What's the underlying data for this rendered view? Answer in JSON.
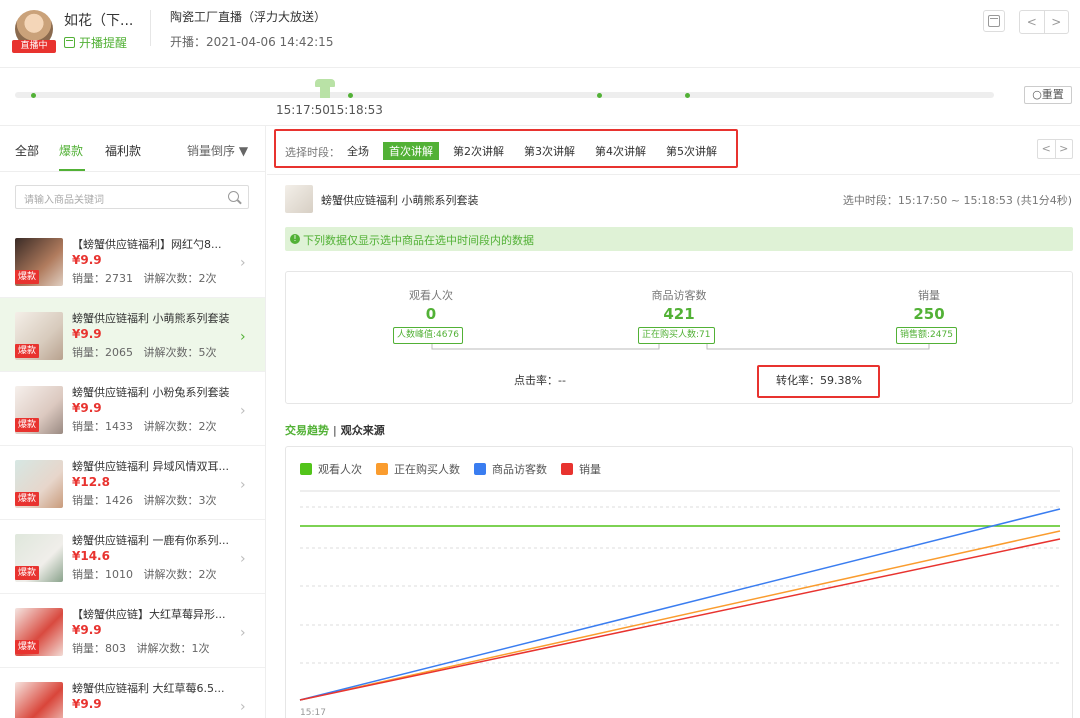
{
  "header": {
    "live_badge": "直播中",
    "anchor_name": "如花（下...",
    "remind": "开播提醒",
    "room_title": "陶瓷工厂直播（浮力大放送）",
    "start_time": "开播：2021-04-06 14:42:15",
    "calendar_icon": "calendar-icon",
    "pager": {
      "prev": "<",
      "next": ">"
    }
  },
  "timeline": {
    "start_label": "15:17:50",
    "end_label": "15:18:53",
    "reset": "重置"
  },
  "left": {
    "tabs": [
      "全部",
      "爆款",
      "福利款"
    ],
    "active_tab": "爆款",
    "sort": "销量倒序 ▼",
    "search_placeholder": "请输入商品关键词",
    "products": [
      {
        "title": "【螃蟹供应链福利】网红勺8...",
        "price": "¥9.9",
        "sales": "销量：2731",
        "explains": "讲解次数：2次",
        "badge": "爆款"
      },
      {
        "title": "螃蟹供应链福利 小萌熊系列套装",
        "price": "¥9.9",
        "sales": "销量：2065",
        "explains": "讲解次数：5次",
        "badge": "爆款"
      },
      {
        "title": "螃蟹供应链福利 小粉兔系列套装",
        "price": "¥9.9",
        "sales": "销量：1433",
        "explains": "讲解次数：2次",
        "badge": "爆款"
      },
      {
        "title": "螃蟹供应链福利 异域风情双耳...",
        "price": "¥12.8",
        "sales": "销量：1426",
        "explains": "讲解次数：3次",
        "badge": "爆款"
      },
      {
        "title": "螃蟹供应链福利 一鹿有你系列...",
        "price": "¥14.6",
        "sales": "销量：1010",
        "explains": "讲解次数：2次",
        "badge": "爆款"
      },
      {
        "title": "【螃蟹供应链】大红草莓异形...",
        "price": "¥9.9",
        "sales": "销量：803",
        "explains": "讲解次数：1次",
        "badge": "爆款"
      },
      {
        "title": "螃蟹供应链福利 大红草莓6.5...",
        "price": "¥9.9",
        "sales": "",
        "explains": "",
        "badge": ""
      }
    ]
  },
  "segments": {
    "label": "选择时段：",
    "items": [
      "全场",
      "首次讲解",
      "第2次讲解",
      "第3次讲解",
      "第4次讲解",
      "第5次讲解"
    ],
    "active": "首次讲解"
  },
  "selected": {
    "name": "螃蟹供应链福利 小萌熊系列套装",
    "range": "选中时段：15:17:50 ~ 15:18:53 (共1分4秒)",
    "notice": "下列数据仅显示选中商品在选中时间段内的数据"
  },
  "metrics": {
    "views": {
      "label": "观看人次",
      "value": "0",
      "tag": "人数峰值:4676"
    },
    "visitors": {
      "label": "商品访客数",
      "value": "421",
      "tag": "正在购买人数:71"
    },
    "sales": {
      "label": "销量",
      "value": "250",
      "tag": "销售额:2475"
    },
    "click_rate": "点击率：--",
    "conversion": "转化率：59.38%"
  },
  "trend": {
    "tab_active": "交易趋势",
    "separator": "|",
    "tab_other": "观众来源"
  },
  "chart_data": {
    "type": "line",
    "x": [
      "15:17"
    ],
    "series": [
      {
        "name": "观看人次",
        "color": "#52c41a",
        "trend": "flat"
      },
      {
        "name": "正在购买人数",
        "color": "#fa9c2e",
        "trend": "rising"
      },
      {
        "name": "商品访客数",
        "color": "#3a7df0",
        "trend": "rising"
      },
      {
        "name": "销量",
        "color": "#e8332f",
        "trend": "rising"
      }
    ],
    "x_tick_labels": [
      "15:17"
    ],
    "grid": true,
    "legend_position": "top-left"
  }
}
